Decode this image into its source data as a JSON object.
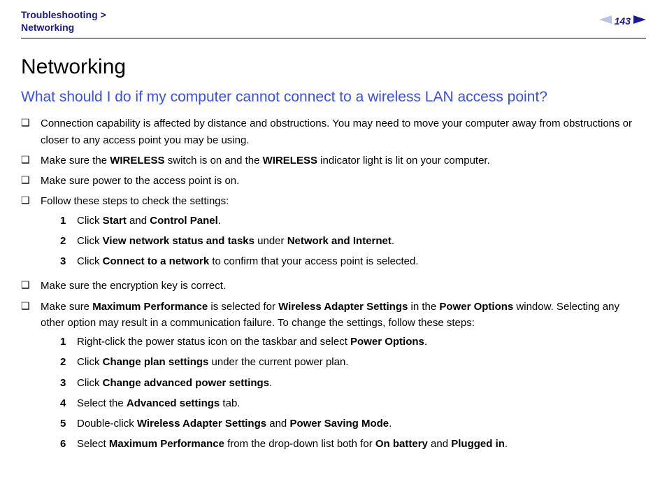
{
  "header": {
    "breadcrumb_line1": "Troubleshooting >",
    "breadcrumb_line2": "Networking",
    "page_number": "143"
  },
  "main": {
    "title": "Networking",
    "question": "What should I do if my computer cannot connect to a wireless LAN access point?",
    "bullets": [
      {
        "text_parts": [
          "Connection capability is affected by distance and obstructions. You may need to move your computer away from obstructions or closer to any access point you may be using."
        ]
      },
      {
        "text_parts": [
          "Make sure the ",
          {
            "b": "WIRELESS"
          },
          " switch is on and the ",
          {
            "b": "WIRELESS"
          },
          " indicator light is lit on your computer."
        ]
      },
      {
        "text_parts": [
          "Make sure power to the access point is on."
        ]
      },
      {
        "text_parts": [
          "Follow these steps to check the settings:"
        ],
        "steps": [
          [
            "Click ",
            {
              "b": "Start"
            },
            " and ",
            {
              "b": "Control Panel"
            },
            "."
          ],
          [
            "Click ",
            {
              "b": "View network status and tasks"
            },
            " under ",
            {
              "b": "Network and Internet"
            },
            "."
          ],
          [
            "Click ",
            {
              "b": "Connect to a network"
            },
            " to confirm that your access point is selected."
          ]
        ]
      },
      {
        "text_parts": [
          "Make sure the encryption key is correct."
        ]
      },
      {
        "text_parts": [
          "Make sure ",
          {
            "b": "Maximum Performance"
          },
          " is selected for ",
          {
            "b": "Wireless Adapter Settings"
          },
          " in the ",
          {
            "b": "Power Options"
          },
          " window. Selecting any other option may result in a communication failure. To change the settings, follow these steps:"
        ],
        "steps": [
          [
            "Right-click the power status icon on the taskbar and select ",
            {
              "b": "Power Options"
            },
            "."
          ],
          [
            "Click ",
            {
              "b": "Change plan settings"
            },
            " under the current power plan."
          ],
          [
            "Click ",
            {
              "b": "Change advanced power settings"
            },
            "."
          ],
          [
            "Select the ",
            {
              "b": "Advanced settings"
            },
            " tab."
          ],
          [
            "Double-click ",
            {
              "b": "Wireless Adapter Settings"
            },
            " and ",
            {
              "b": "Power Saving Mode"
            },
            "."
          ],
          [
            "Select ",
            {
              "b": "Maximum Performance"
            },
            " from the drop-down list both for ",
            {
              "b": "On battery"
            },
            " and ",
            {
              "b": "Plugged in"
            },
            "."
          ]
        ]
      }
    ]
  }
}
